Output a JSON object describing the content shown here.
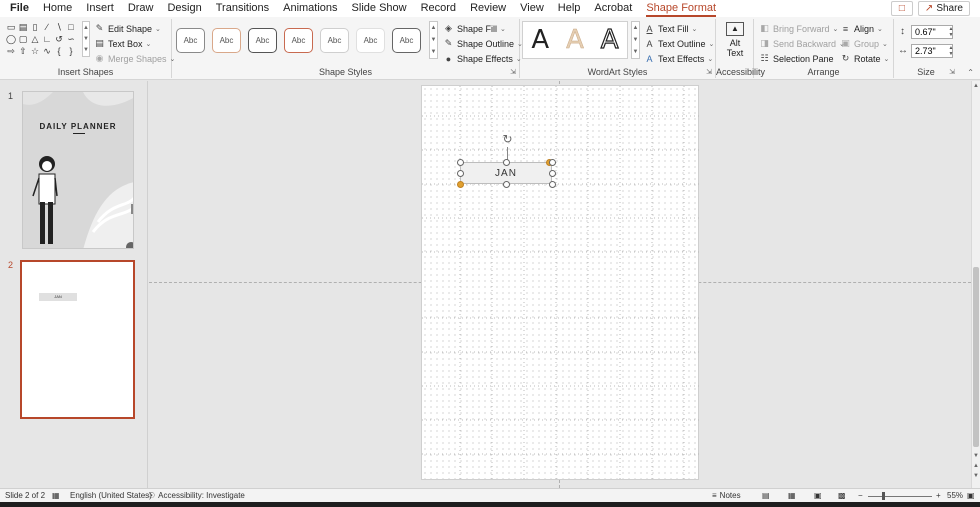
{
  "menu": {
    "tabs": [
      "File",
      "Home",
      "Insert",
      "Draw",
      "Design",
      "Transitions",
      "Animations",
      "Slide Show",
      "Record",
      "Review",
      "View",
      "Help",
      "Acrobat",
      "Shape Format"
    ],
    "active_tab": "Shape Format",
    "share_label": "Share"
  },
  "ribbon": {
    "insert_shapes": {
      "label": "Insert Shapes",
      "edit_shape": "Edit Shape",
      "text_box": "Text Box",
      "merge_shapes": "Merge Shapes"
    },
    "shape_styles": {
      "label": "Shape Styles",
      "swatch_text": "Abc",
      "swatch_borders": [
        "#8a8a8a",
        "#d9a88a",
        "#555555",
        "#c86a50",
        "#cfcfcf",
        "#e0e0e0",
        "#666666"
      ],
      "shape_fill": "Shape Fill",
      "shape_outline": "Shape Outline",
      "shape_effects": "Shape Effects"
    },
    "wordart": {
      "label": "WordArt Styles",
      "letter": "A",
      "text_fill": "Text Fill",
      "text_outline": "Text Outline",
      "text_effects": "Text Effects"
    },
    "accessibility": {
      "label": "Accessibility",
      "alt_text_line1": "Alt",
      "alt_text_line2": "Text"
    },
    "arrange": {
      "label": "Arrange",
      "bring_forward": "Bring Forward",
      "send_backward": "Send Backward",
      "selection_pane": "Selection Pane",
      "align": "Align",
      "group": "Group",
      "rotate": "Rotate"
    },
    "size": {
      "label": "Size",
      "height": "0.67\"",
      "width": "2.73\""
    }
  },
  "thumbnails": {
    "slide1_number": "1",
    "slide1_title": "DAILY PLANNER",
    "slide2_number": "2",
    "slide2_text": "JAN"
  },
  "slide": {
    "textbox_text": "JAN"
  },
  "status": {
    "slide_info": "Slide 2 of 2",
    "language": "English (United States)",
    "accessibility": "Accessibility: Investigate",
    "notes": "Notes",
    "zoom": "55%"
  },
  "colors": {
    "accent": "#b7472a"
  }
}
